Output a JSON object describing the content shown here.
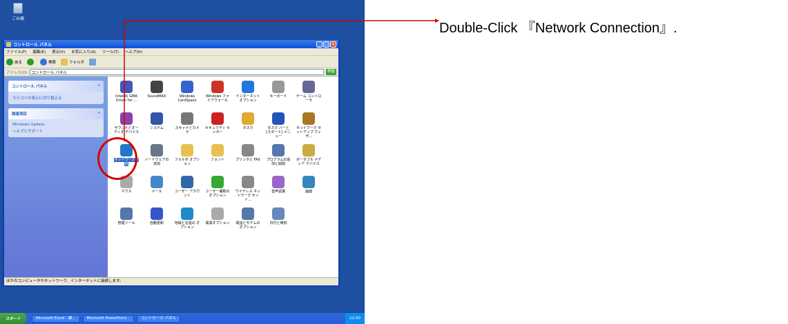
{
  "annotation": {
    "text": "Double-Click 『Network Connection』."
  },
  "desktop": {
    "recycle_label": "ごみ箱"
  },
  "window": {
    "title": "コントロール パネル",
    "menu": [
      "ファイル(F)",
      "編集(E)",
      "表示(V)",
      "お気に入り(A)",
      "ツール(T)",
      "ヘルプ(H)"
    ],
    "toolbar": {
      "back": "戻る",
      "search": "検索",
      "folders": "フォルダ"
    },
    "address": {
      "label": "アドレス(D)",
      "value": "コントロール パネル",
      "go": "移動"
    },
    "sidebar": {
      "panel1": {
        "title": "コントロール パネル",
        "items": [
          "カテゴリの表示に切り替える"
        ]
      },
      "panel2": {
        "title": "関連項目",
        "items": [
          "Windows Update",
          "ヘルプとサポート"
        ]
      }
    },
    "icons": [
      {
        "label": "Intel(R) GMA Driver for ...",
        "color": "#4455bb"
      },
      {
        "label": "SoundMAX",
        "color": "#444444"
      },
      {
        "label": "Windows CardSpace",
        "color": "#3366cc"
      },
      {
        "label": "Windows ファイアウォール",
        "color": "#cc3322"
      },
      {
        "label": "インターネット オプション",
        "color": "#2277dd"
      },
      {
        "label": "キーボード",
        "color": "#999999"
      },
      {
        "label": "ゲーム コントローラ",
        "color": "#666699"
      },
      {
        "label": "サウンドとオーディオ デバイス",
        "color": "#8844aa"
      },
      {
        "label": "システム",
        "color": "#3355aa"
      },
      {
        "label": "スキャナとカメラ",
        "color": "#777777"
      },
      {
        "label": "セキュリティ センター",
        "color": "#cc2222"
      },
      {
        "label": "タスク",
        "color": "#ddaa33"
      },
      {
        "label": "タスク バーと [スタート] メニュー",
        "color": "#2255bb"
      },
      {
        "label": "ネットワーク セットアップ ウィザ...",
        "color": "#aa7722"
      },
      {
        "label": "ネットワーク接続",
        "color": "#2277cc"
      },
      {
        "label": "ハードウェアの追加",
        "color": "#667788"
      },
      {
        "label": "フォルダ オプション",
        "color": "#e8c050"
      },
      {
        "label": "フォント",
        "color": "#e8c050"
      },
      {
        "label": "プリンタと FAX",
        "color": "#888888"
      },
      {
        "label": "プログラムの追加と削除",
        "color": "#5577aa"
      },
      {
        "label": "ポータブル メディア デバイス",
        "color": "#ccaa44"
      },
      {
        "label": "マウス",
        "color": "#aaaaaa"
      },
      {
        "label": "メール",
        "color": "#4488cc"
      },
      {
        "label": "ユーザー アカウント",
        "color": "#3366aa"
      },
      {
        "label": "ユーザー補助の オプション",
        "color": "#33aa33"
      },
      {
        "label": "ワイヤレス ネットワーク セット...",
        "color": "#888888"
      },
      {
        "label": "音声認識",
        "color": "#9966cc"
      },
      {
        "label": "画面",
        "color": "#3388bb"
      },
      {
        "label": "管理ツール",
        "color": "#5577aa"
      },
      {
        "label": "自動更新",
        "color": "#3355cc"
      },
      {
        "label": "地域と言語の オプション",
        "color": "#2288cc"
      },
      {
        "label": "電源オプション",
        "color": "#aaaaaa"
      },
      {
        "label": "電話とモデムの オプション",
        "color": "#5577aa"
      },
      {
        "label": "日付と時刻",
        "color": "#6688bb"
      }
    ],
    "selected_icon_index": 14,
    "status": "ほかのコンピュータやネットワーク、インターネットに接続します。"
  },
  "taskbar": {
    "start": "スタート",
    "tasks": [
      "Microsoft Excel - 業...",
      "Microsoft PowerPoint...",
      "コントロール パネル"
    ],
    "time": "11:00"
  },
  "colors": {
    "highlight": "#d40000",
    "desktop": "#1e4fa0"
  }
}
